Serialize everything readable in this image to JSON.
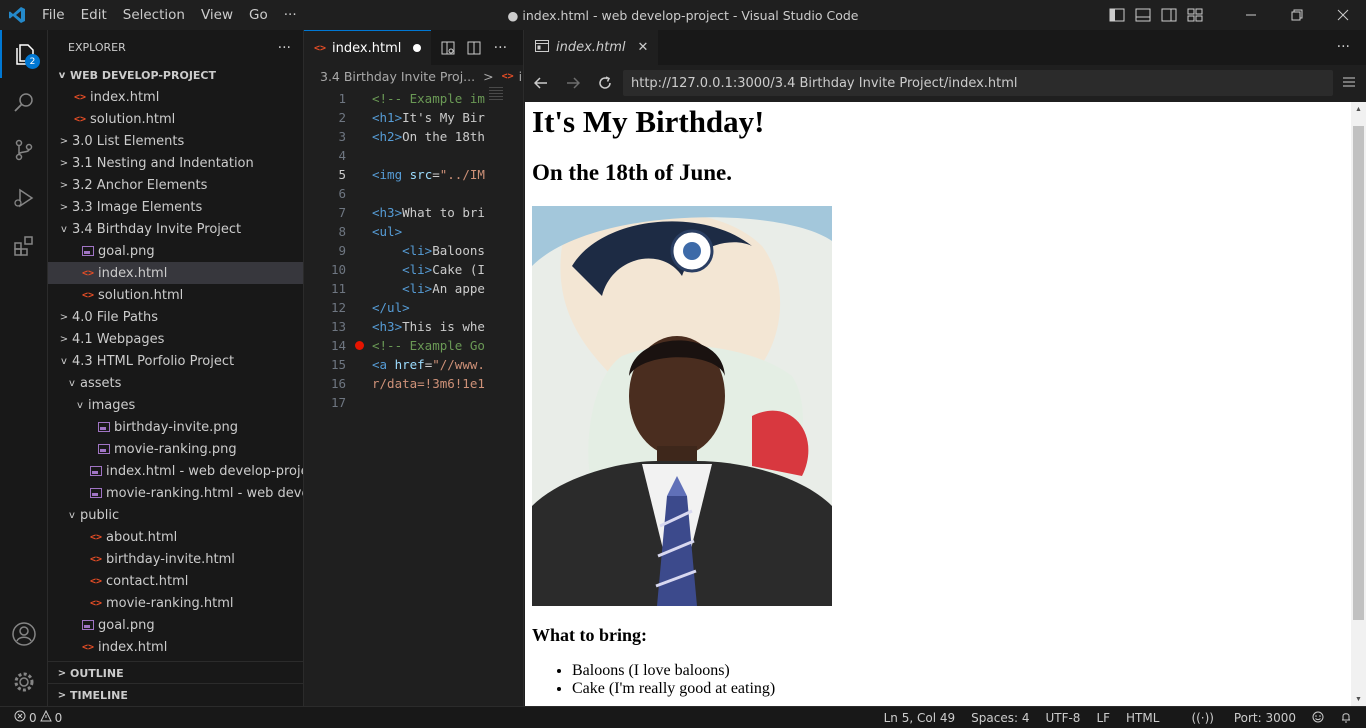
{
  "titlebar": {
    "menu": [
      "File",
      "Edit",
      "Selection",
      "View",
      "Go",
      "···"
    ],
    "title": "● index.html - web develop-project - Visual Studio Code"
  },
  "activitybar": {
    "explorer_badge": "2"
  },
  "sidebar": {
    "header": "EXPLORER",
    "more": "···",
    "root": "WEB DEVELOP-PROJECT",
    "tree": [
      {
        "label": "index.html",
        "kind": "html",
        "depth": 1,
        "chevron": ""
      },
      {
        "label": "solution.html",
        "kind": "html",
        "depth": 1,
        "chevron": ""
      },
      {
        "label": "3.0 List Elements",
        "kind": "folder",
        "depth": 1,
        "chevron": ">"
      },
      {
        "label": "3.1 Nesting and Indentation",
        "kind": "folder",
        "depth": 1,
        "chevron": ">"
      },
      {
        "label": "3.2 Anchor Elements",
        "kind": "folder",
        "depth": 1,
        "chevron": ">"
      },
      {
        "label": "3.3 Image Elements",
        "kind": "folder",
        "depth": 1,
        "chevron": ">"
      },
      {
        "label": "3.4 Birthday Invite Project",
        "kind": "folder",
        "depth": 1,
        "chevron": "v"
      },
      {
        "label": "goal.png",
        "kind": "img",
        "depth": 2,
        "chevron": ""
      },
      {
        "label": "index.html",
        "kind": "html",
        "depth": 2,
        "chevron": "",
        "selected": true
      },
      {
        "label": "solution.html",
        "kind": "html",
        "depth": 2,
        "chevron": ""
      },
      {
        "label": "4.0 File Paths",
        "kind": "folder",
        "depth": 1,
        "chevron": ">"
      },
      {
        "label": "4.1 Webpages",
        "kind": "folder",
        "depth": 1,
        "chevron": ">"
      },
      {
        "label": "4.3 HTML Porfolio Project",
        "kind": "folder",
        "depth": 1,
        "chevron": "v"
      },
      {
        "label": "assets",
        "kind": "folder",
        "depth": 2,
        "chevron": "v"
      },
      {
        "label": "images",
        "kind": "folder",
        "depth": 3,
        "chevron": "v"
      },
      {
        "label": "birthday-invite.png",
        "kind": "img",
        "depth": 4,
        "chevron": ""
      },
      {
        "label": "movie-ranking.png",
        "kind": "img",
        "depth": 4,
        "chevron": ""
      },
      {
        "label": "index.html - web develop-project ...",
        "kind": "img",
        "depth": 3,
        "chevron": ""
      },
      {
        "label": "movie-ranking.html - web develo...",
        "kind": "img",
        "depth": 3,
        "chevron": ""
      },
      {
        "label": "public",
        "kind": "folder",
        "depth": 2,
        "chevron": "v"
      },
      {
        "label": "about.html",
        "kind": "html",
        "depth": 3,
        "chevron": ""
      },
      {
        "label": "birthday-invite.html",
        "kind": "html",
        "depth": 3,
        "chevron": ""
      },
      {
        "label": "contact.html",
        "kind": "html",
        "depth": 3,
        "chevron": ""
      },
      {
        "label": "movie-ranking.html",
        "kind": "html",
        "depth": 3,
        "chevron": ""
      },
      {
        "label": "goal.png",
        "kind": "img",
        "depth": 2,
        "chevron": ""
      },
      {
        "label": "index.html",
        "kind": "html",
        "depth": 2,
        "chevron": ""
      }
    ],
    "outline": "OUTLINE",
    "timeline": "TIMELINE"
  },
  "editor": {
    "tab_label": "index.html",
    "breadcrumb_folder": "3.4 Birthday Invite Proj...",
    "breadcrumb_file": "inde",
    "current_line": 5,
    "breakpoint_line": 14,
    "lines": [
      {
        "n": "1",
        "parts": [
          {
            "t": "<!-- Example im",
            "c": "com"
          }
        ]
      },
      {
        "n": "2",
        "parts": [
          {
            "t": "<h1>",
            "c": "tag"
          },
          {
            "t": "It's My Bir",
            "c": "txt"
          }
        ]
      },
      {
        "n": "3",
        "parts": [
          {
            "t": "<h2>",
            "c": "tag"
          },
          {
            "t": "On the 18th",
            "c": "txt"
          }
        ]
      },
      {
        "n": "4",
        "parts": []
      },
      {
        "n": "5",
        "parts": [
          {
            "t": "<img ",
            "c": "tag"
          },
          {
            "t": "src",
            "c": "attr"
          },
          {
            "t": "=",
            "c": "txt"
          },
          {
            "t": "\"../IM",
            "c": "str"
          }
        ]
      },
      {
        "n": "6",
        "parts": []
      },
      {
        "n": "7",
        "parts": [
          {
            "t": "<h3>",
            "c": "tag"
          },
          {
            "t": "What to bri",
            "c": "txt"
          }
        ]
      },
      {
        "n": "8",
        "parts": [
          {
            "t": "<ul>",
            "c": "tag"
          }
        ]
      },
      {
        "n": "9",
        "parts": [
          {
            "t": "    <li>",
            "c": "tag"
          },
          {
            "t": "Baloons",
            "c": "txt"
          }
        ]
      },
      {
        "n": "10",
        "parts": [
          {
            "t": "    <li>",
            "c": "tag"
          },
          {
            "t": "Cake (I",
            "c": "txt"
          }
        ]
      },
      {
        "n": "11",
        "parts": [
          {
            "t": "    <li>",
            "c": "tag"
          },
          {
            "t": "An appe",
            "c": "txt"
          }
        ]
      },
      {
        "n": "12",
        "parts": [
          {
            "t": "</ul>",
            "c": "tag"
          }
        ]
      },
      {
        "n": "13",
        "parts": [
          {
            "t": "<h3>",
            "c": "tag"
          },
          {
            "t": "This is whe",
            "c": "txt"
          }
        ]
      },
      {
        "n": "14",
        "parts": [
          {
            "t": "<!-- Example Go",
            "c": "com"
          }
        ]
      },
      {
        "n": "15",
        "parts": [
          {
            "t": "<a ",
            "c": "tag"
          },
          {
            "t": "href",
            "c": "attr"
          },
          {
            "t": "=",
            "c": "txt"
          },
          {
            "t": "\"//www.",
            "c": "str"
          }
        ]
      },
      {
        "n": "16",
        "parts": [
          {
            "t": "r/data=!3m6!1e1",
            "c": "str"
          }
        ]
      },
      {
        "n": "17",
        "parts": []
      }
    ]
  },
  "browser": {
    "tab_label": "index.html",
    "url": "http://127.0.0.1:3000/3.4 Birthday Invite Project/index.html",
    "page": {
      "h1": "It's My Birthday!",
      "h2": "On the 18th of June.",
      "h3": "What to bring:",
      "list": [
        "Baloons (I love baloons)",
        "Cake (I'm really good at eating)"
      ]
    }
  },
  "statusbar": {
    "errors": "0",
    "warnings": "0",
    "position": "Ln 5, Col 49",
    "spaces": "Spaces: 4",
    "encoding": "UTF-8",
    "eol": "LF",
    "language": "HTML",
    "port": "Port: 3000"
  },
  "colors": {
    "accent": "#0078d4",
    "html_icon": "#e44d26",
    "image_icon": "#a074c4",
    "breakpoint": "#e51400"
  }
}
